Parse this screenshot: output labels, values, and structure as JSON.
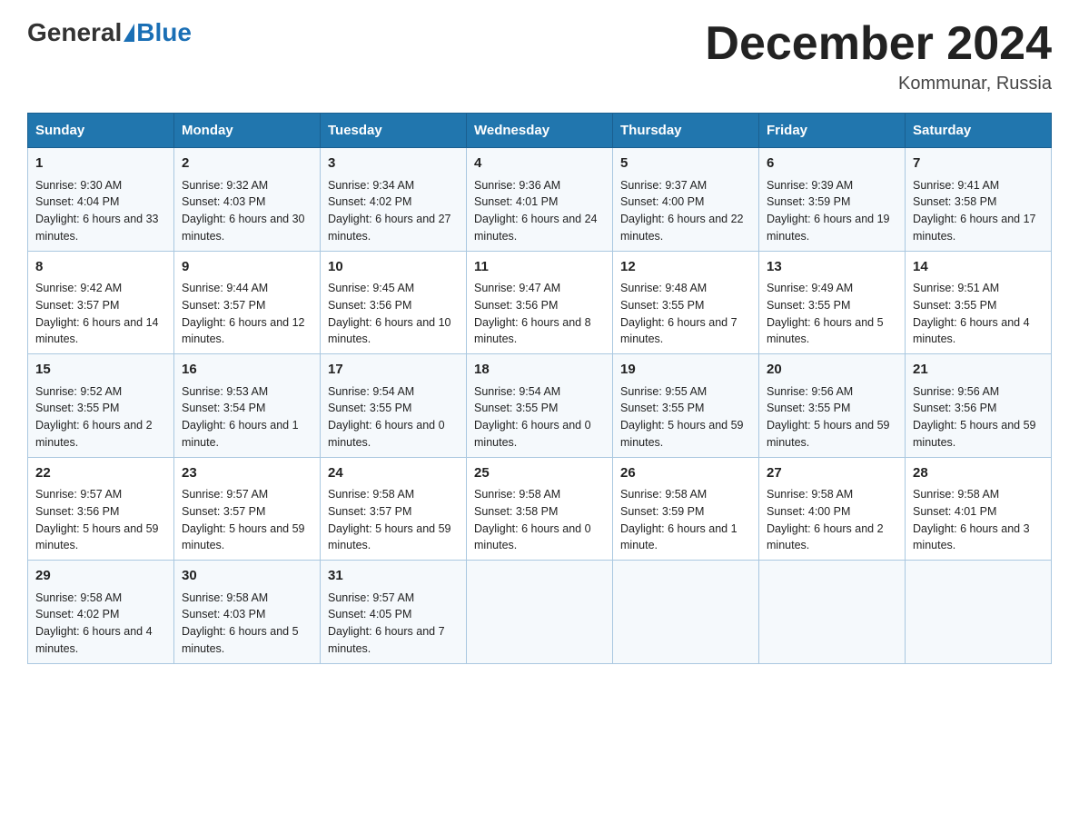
{
  "header": {
    "logo_general": "General",
    "logo_blue": "Blue",
    "title": "December 2024",
    "location": "Kommunar, Russia"
  },
  "days_of_week": [
    "Sunday",
    "Monday",
    "Tuesday",
    "Wednesday",
    "Thursday",
    "Friday",
    "Saturday"
  ],
  "weeks": [
    [
      {
        "day": "1",
        "sunrise": "9:30 AM",
        "sunset": "4:04 PM",
        "daylight": "6 hours and 33 minutes."
      },
      {
        "day": "2",
        "sunrise": "9:32 AM",
        "sunset": "4:03 PM",
        "daylight": "6 hours and 30 minutes."
      },
      {
        "day": "3",
        "sunrise": "9:34 AM",
        "sunset": "4:02 PM",
        "daylight": "6 hours and 27 minutes."
      },
      {
        "day": "4",
        "sunrise": "9:36 AM",
        "sunset": "4:01 PM",
        "daylight": "6 hours and 24 minutes."
      },
      {
        "day": "5",
        "sunrise": "9:37 AM",
        "sunset": "4:00 PM",
        "daylight": "6 hours and 22 minutes."
      },
      {
        "day": "6",
        "sunrise": "9:39 AM",
        "sunset": "3:59 PM",
        "daylight": "6 hours and 19 minutes."
      },
      {
        "day": "7",
        "sunrise": "9:41 AM",
        "sunset": "3:58 PM",
        "daylight": "6 hours and 17 minutes."
      }
    ],
    [
      {
        "day": "8",
        "sunrise": "9:42 AM",
        "sunset": "3:57 PM",
        "daylight": "6 hours and 14 minutes."
      },
      {
        "day": "9",
        "sunrise": "9:44 AM",
        "sunset": "3:57 PM",
        "daylight": "6 hours and 12 minutes."
      },
      {
        "day": "10",
        "sunrise": "9:45 AM",
        "sunset": "3:56 PM",
        "daylight": "6 hours and 10 minutes."
      },
      {
        "day": "11",
        "sunrise": "9:47 AM",
        "sunset": "3:56 PM",
        "daylight": "6 hours and 8 minutes."
      },
      {
        "day": "12",
        "sunrise": "9:48 AM",
        "sunset": "3:55 PM",
        "daylight": "6 hours and 7 minutes."
      },
      {
        "day": "13",
        "sunrise": "9:49 AM",
        "sunset": "3:55 PM",
        "daylight": "6 hours and 5 minutes."
      },
      {
        "day": "14",
        "sunrise": "9:51 AM",
        "sunset": "3:55 PM",
        "daylight": "6 hours and 4 minutes."
      }
    ],
    [
      {
        "day": "15",
        "sunrise": "9:52 AM",
        "sunset": "3:55 PM",
        "daylight": "6 hours and 2 minutes."
      },
      {
        "day": "16",
        "sunrise": "9:53 AM",
        "sunset": "3:54 PM",
        "daylight": "6 hours and 1 minute."
      },
      {
        "day": "17",
        "sunrise": "9:54 AM",
        "sunset": "3:55 PM",
        "daylight": "6 hours and 0 minutes."
      },
      {
        "day": "18",
        "sunrise": "9:54 AM",
        "sunset": "3:55 PM",
        "daylight": "6 hours and 0 minutes."
      },
      {
        "day": "19",
        "sunrise": "9:55 AM",
        "sunset": "3:55 PM",
        "daylight": "5 hours and 59 minutes."
      },
      {
        "day": "20",
        "sunrise": "9:56 AM",
        "sunset": "3:55 PM",
        "daylight": "5 hours and 59 minutes."
      },
      {
        "day": "21",
        "sunrise": "9:56 AM",
        "sunset": "3:56 PM",
        "daylight": "5 hours and 59 minutes."
      }
    ],
    [
      {
        "day": "22",
        "sunrise": "9:57 AM",
        "sunset": "3:56 PM",
        "daylight": "5 hours and 59 minutes."
      },
      {
        "day": "23",
        "sunrise": "9:57 AM",
        "sunset": "3:57 PM",
        "daylight": "5 hours and 59 minutes."
      },
      {
        "day": "24",
        "sunrise": "9:58 AM",
        "sunset": "3:57 PM",
        "daylight": "5 hours and 59 minutes."
      },
      {
        "day": "25",
        "sunrise": "9:58 AM",
        "sunset": "3:58 PM",
        "daylight": "6 hours and 0 minutes."
      },
      {
        "day": "26",
        "sunrise": "9:58 AM",
        "sunset": "3:59 PM",
        "daylight": "6 hours and 1 minute."
      },
      {
        "day": "27",
        "sunrise": "9:58 AM",
        "sunset": "4:00 PM",
        "daylight": "6 hours and 2 minutes."
      },
      {
        "day": "28",
        "sunrise": "9:58 AM",
        "sunset": "4:01 PM",
        "daylight": "6 hours and 3 minutes."
      }
    ],
    [
      {
        "day": "29",
        "sunrise": "9:58 AM",
        "sunset": "4:02 PM",
        "daylight": "6 hours and 4 minutes."
      },
      {
        "day": "30",
        "sunrise": "9:58 AM",
        "sunset": "4:03 PM",
        "daylight": "6 hours and 5 minutes."
      },
      {
        "day": "31",
        "sunrise": "9:57 AM",
        "sunset": "4:05 PM",
        "daylight": "6 hours and 7 minutes."
      },
      null,
      null,
      null,
      null
    ]
  ],
  "labels": {
    "sunrise": "Sunrise:",
    "sunset": "Sunset:",
    "daylight": "Daylight:"
  }
}
